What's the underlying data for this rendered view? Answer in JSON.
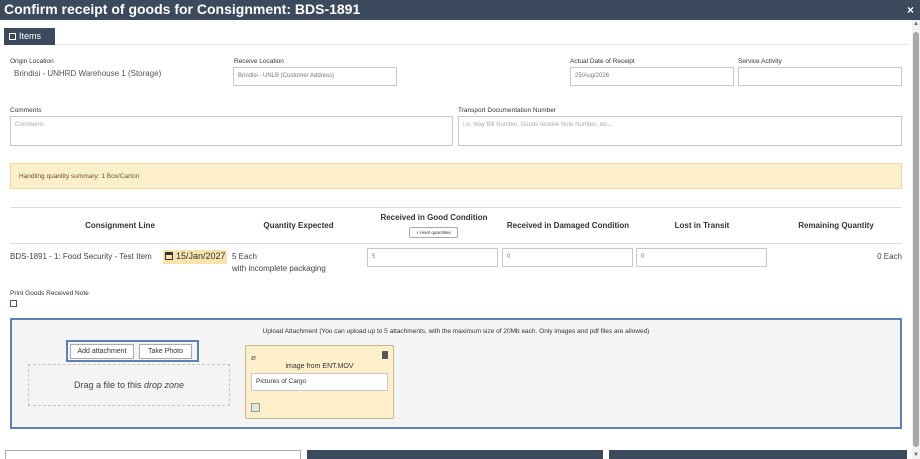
{
  "window": {
    "title": "Confirm receipt of goods for Consignment: BDS-1891",
    "close_symbol": "×"
  },
  "tabs": [
    {
      "label": "Items"
    }
  ],
  "form": {
    "origin_location": {
      "label": "Origin Location",
      "value": "Brindisi - UNHRD Warehouse 1 (Storage)"
    },
    "receive_location": {
      "label": "Receive Location",
      "value": "Brindisi - UNLB (Customer Address)"
    },
    "actual_date": {
      "label": "Actual Date of Receipt",
      "value": "25/Aug/2026"
    },
    "service_activity": {
      "label": "Service Activity",
      "value": ""
    },
    "comments": {
      "label": "Comments",
      "placeholder": "Comments"
    },
    "transport_doc": {
      "label": "Transport Documentation Number",
      "placeholder": "I.e. Way Bill Number, Goods receive Note Number, etc..."
    }
  },
  "summary": "Handling quantity summary: 1 Box/Carton",
  "table": {
    "headers": {
      "consignment_line": "Consignment Line",
      "quantity_expected": "Quantity Expected",
      "received_good": "Received in Good Condition",
      "reset_label": "× reset quantities",
      "received_damaged": "Received in Damaged Condition",
      "lost": "Lost in Transit",
      "remaining": "Remaining Quantity"
    },
    "rows": [
      {
        "line": "BDS-1891 - 1: Food Security - Test Item",
        "date": "15/Jan/2027",
        "qty_expected": "5 Each",
        "qty_note": "with incomplete packaging",
        "good": "5",
        "damaged": "0",
        "lost": "0",
        "remaining": "0 Each"
      }
    ]
  },
  "print_note": {
    "label": "Print Goods Received Note"
  },
  "upload": {
    "title": "Upload Attachment (You can upload up to 5 attachments, with the maximum size of 20Mb each. Only images and pdf files are allowed)",
    "add_label": "Add attachment",
    "photo_label": "Take Photo",
    "drop_prefix": "Drag a file to this ",
    "drop_em": "drop zone",
    "attachment": {
      "filename": "image from ENT.MOV",
      "description": "Pictures of Cargo"
    }
  },
  "colors": {
    "header": "#3b4a5c",
    "highlight": "#5b84b1",
    "warn_bg": "#fcefcc",
    "card_bg": "#fdefc9"
  }
}
